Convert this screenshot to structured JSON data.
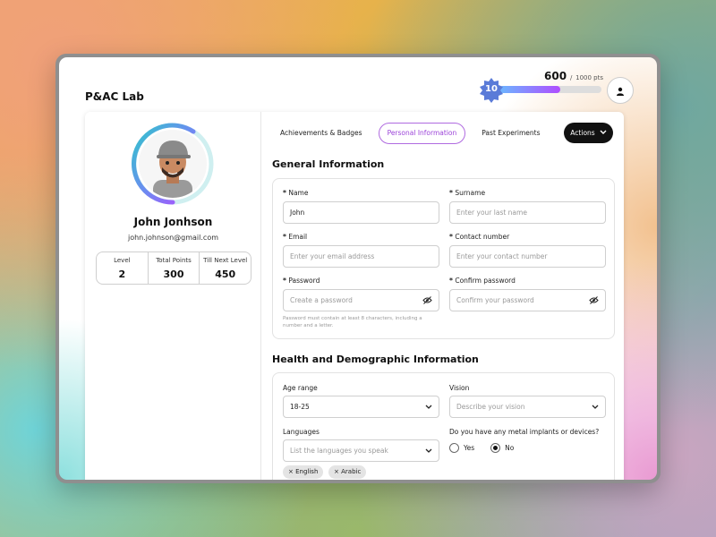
{
  "app": {
    "title": "P&AC Lab"
  },
  "points": {
    "current": "600",
    "total": "1000 pts",
    "separator": "/",
    "progress_fraction": 0.6,
    "level_badge": "10"
  },
  "profile": {
    "name": "John Jonhson",
    "email": "john.johnson@gmail.com",
    "stats": [
      {
        "label": "Level",
        "value": "2"
      },
      {
        "label": "Total Points",
        "value": "300"
      },
      {
        "label": "Till Next Level",
        "value": "450"
      }
    ]
  },
  "tabs": [
    {
      "label": "Achievements & Badges",
      "active": false
    },
    {
      "label": "Personal Information",
      "active": true
    },
    {
      "label": "Past Experiments",
      "active": false
    }
  ],
  "actions": {
    "label": "Actions"
  },
  "general": {
    "title": "General Information",
    "name_label": "Name",
    "name_value": "John",
    "surname_label": "Surname",
    "surname_placeholder": "Enter your last name",
    "email_label": "Email",
    "email_placeholder": "Enter your email address",
    "contact_label": "Contact number",
    "contact_placeholder": "Enter your contact number",
    "password_label": "Password",
    "password_placeholder": "Create a password",
    "confirm_label": "Confirm password",
    "confirm_placeholder": "Confirm your password",
    "password_hint": "Password must contain at least 8 characters, including a number and a letter.",
    "required_mark": "*"
  },
  "health": {
    "title": "Health and Demographic Information",
    "age_label": "Age range",
    "age_value": "18-25",
    "vision_label": "Vision",
    "vision_placeholder": "Describe your vision",
    "languages_label": "Languages",
    "languages_placeholder": "List the languages you speak",
    "implants_label": "Do you have any metal implants or devices?",
    "yes_label": "Yes",
    "no_label": "No",
    "implants_selected": "No",
    "chips": [
      "English",
      "Arabic"
    ],
    "chip_remove": "×"
  },
  "icons": {
    "user": "user-icon",
    "chevron": "chevron-down-icon",
    "eye_off": "eye-off-icon",
    "badge": "level-badge-icon"
  },
  "colors": {
    "accent": "#9c44d9",
    "progress_start": "#6bb6ff",
    "progress_end": "#b04dff",
    "badge": "#5a7bd8"
  }
}
